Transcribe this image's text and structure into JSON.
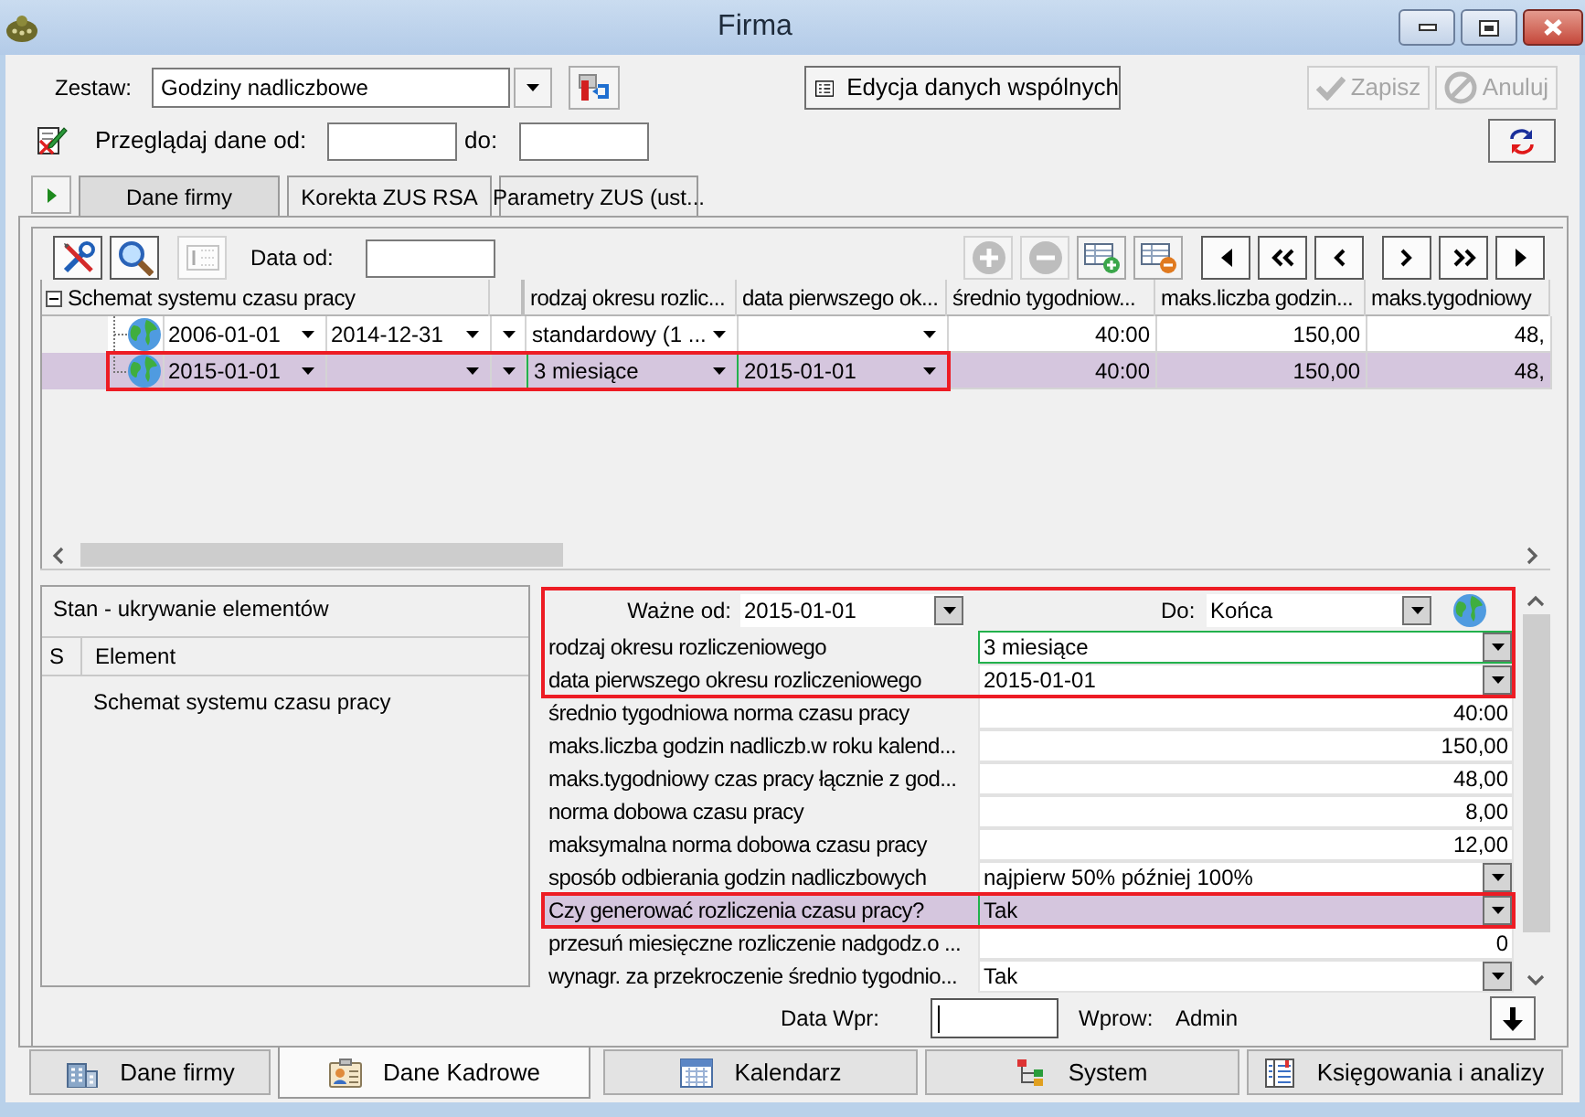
{
  "window": {
    "title": "Firma"
  },
  "header": {
    "set_label": "Zestaw:",
    "set_value": "Godziny nadliczbowe",
    "shared_button": "Edycja danych wspólnych",
    "actions": [
      {
        "label": "Zapisz",
        "kind": "save",
        "disabled": true
      },
      {
        "label": "Anuluj",
        "kind": "cancel",
        "disabled": true
      }
    ],
    "browse_label": "Przeglądaj dane od:",
    "browse_to_label": "do:"
  },
  "tabs": [
    {
      "label": "Dane firmy",
      "selected": true
    },
    {
      "label": "Korekta ZUS RSA",
      "selected": false
    },
    {
      "label": "Parametry ZUS (ust...",
      "selected": false
    }
  ],
  "grid_toolbar": {
    "date_label": "Data od:",
    "tools": [
      {
        "kind": "tools",
        "disabled": false
      },
      {
        "kind": "search",
        "disabled": false
      },
      {
        "kind": "numbering",
        "disabled": true
      }
    ],
    "record_buttons": [
      {
        "kind": "add",
        "disabled": true
      },
      {
        "kind": "remove",
        "disabled": true
      },
      {
        "kind": "add_record",
        "disabled": false
      },
      {
        "kind": "remove_record",
        "disabled": false
      }
    ],
    "nav_buttons": [
      {
        "kind": "first"
      },
      {
        "kind": "page_back"
      },
      {
        "kind": "back"
      },
      {
        "kind": "forward"
      },
      {
        "kind": "page_forward"
      },
      {
        "kind": "last"
      }
    ]
  },
  "grid": {
    "tree_header": "Schemat systemu czasu pracy",
    "expanded": true,
    "columns": [
      {
        "label": "rodzaj okresu rozlic...",
        "kind": "combo"
      },
      {
        "label": "data pierwszego ok...",
        "kind": "combo"
      },
      {
        "label": "średnio tygodniow...",
        "kind": "number"
      },
      {
        "label": "maks.liczba godzin...",
        "kind": "number"
      },
      {
        "label": "maks.tygodniowy",
        "kind": "number"
      }
    ],
    "rows": [
      {
        "selected": false,
        "annotated": false,
        "date_from": "2006-01-01",
        "date_to": "2014-12-31",
        "cells": [
          {
            "text": "standardowy (1 ...",
            "focused": false
          },
          {
            "focused": false
          },
          {
            "text": "40:00",
            "focused": false
          },
          {
            "text": "150,00",
            "focused": false
          },
          {
            "text": "48,",
            "focused": false
          }
        ]
      },
      {
        "selected": true,
        "annotated": true,
        "date_from": "2015-01-01",
        "cells": [
          {
            "text": "3 miesiące",
            "focused": true
          },
          {
            "text": "2015-01-01",
            "focused": false
          },
          {
            "text": "40:00",
            "focused": false
          },
          {
            "text": "150,00",
            "focused": false
          },
          {
            "text": "48,",
            "focused": false
          }
        ]
      }
    ]
  },
  "hidden_elements": {
    "title": "Stan - ukrywanie elementów",
    "columns": [
      "S",
      "Element"
    ],
    "rows": [
      {
        "element": "Schemat systemu czasu pracy"
      }
    ]
  },
  "details": {
    "validity": {
      "from_label": "Ważne od:",
      "from": "2015-01-01",
      "to_label": "Do:",
      "to": "Końca",
      "annotated": true
    },
    "rows": [
      {
        "label": "rodzaj okresu rozliczeniowego",
        "value": "3 miesiące",
        "kind": "combo",
        "selected": false,
        "focused": true,
        "annotated": true
      },
      {
        "label": "data pierwszego okresu rozliczeniowego",
        "value": "2015-01-01",
        "kind": "combo",
        "selected": false,
        "focused": false,
        "annotated": true
      },
      {
        "label": "średnio tygodniowa norma czasu pracy",
        "value": "40:00",
        "kind": "number",
        "selected": false,
        "focused": false,
        "annotated": false
      },
      {
        "label": "maks.liczba godzin nadliczb.w roku kalend...",
        "value": "150,00",
        "kind": "number",
        "selected": false,
        "focused": false,
        "annotated": false
      },
      {
        "label": "maks.tygodniowy czas pracy łącznie z god...",
        "value": "48,00",
        "kind": "number",
        "selected": false,
        "focused": false,
        "annotated": false
      },
      {
        "label": "norma dobowa czasu pracy",
        "value": "8,00",
        "kind": "number",
        "selected": false,
        "focused": false,
        "annotated": false
      },
      {
        "label": "maksymalna norma dobowa czasu pracy",
        "value": "12,00",
        "kind": "number",
        "selected": false,
        "focused": false,
        "annotated": false
      },
      {
        "label": "sposób odbierania godzin nadliczbowych",
        "value": "najpierw 50% później 100%",
        "kind": "combo",
        "selected": false,
        "focused": false,
        "annotated": false
      },
      {
        "label": "Czy generować rozliczenia czasu pracy?",
        "value": "Tak",
        "kind": "combo",
        "selected": true,
        "focused": true,
        "annotated": true
      },
      {
        "label": "przesuń miesięczne rozliczenie nadgodz.o ...",
        "value": "0",
        "kind": "number",
        "selected": false,
        "focused": false,
        "annotated": false
      },
      {
        "label": "wynagr. za przekroczenie średnio tygodnio...",
        "value": "Tak",
        "kind": "combo",
        "selected": false,
        "focused": false,
        "annotated": false
      }
    ]
  },
  "footer": {
    "date_label": "Data Wpr:",
    "user_label": "Wprow:",
    "user": "Admin"
  },
  "bottom_tabs": [
    {
      "label": "Dane firmy",
      "kind": "company",
      "selected": false
    },
    {
      "label": "Dane Kadrowe",
      "kind": "staff",
      "selected": true
    },
    {
      "label": "Kalendarz",
      "kind": "calendar",
      "selected": false
    },
    {
      "label": "System",
      "kind": "system",
      "selected": false
    },
    {
      "label": "Księgowania i analizy",
      "kind": "ledger",
      "selected": false
    }
  ]
}
